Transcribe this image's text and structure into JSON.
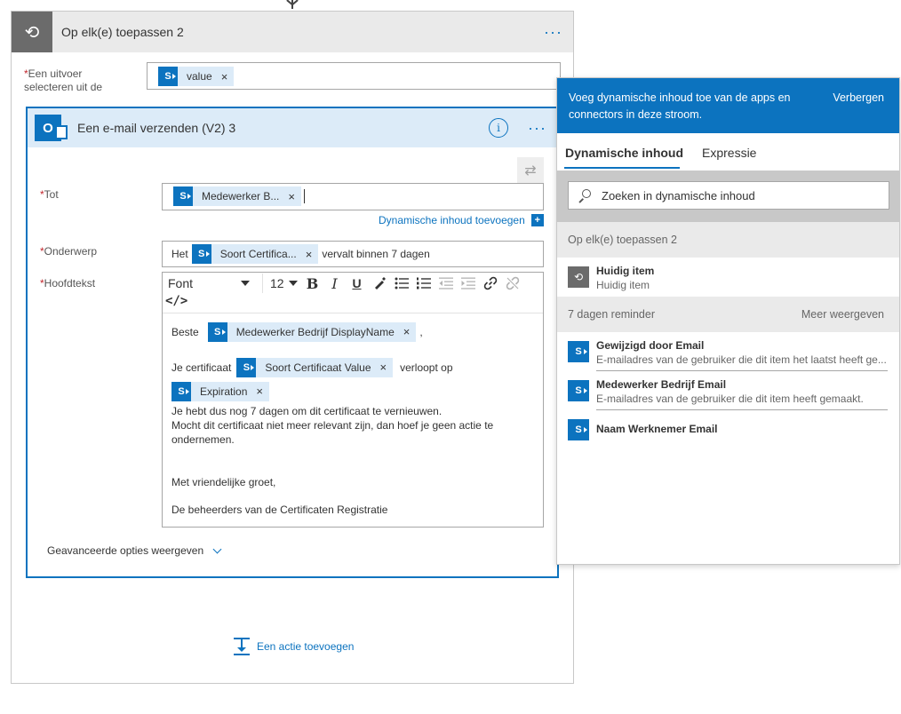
{
  "loop": {
    "title": "Op elk(e) toepassen 2",
    "more": "···",
    "select_label_req": "*",
    "select_label": "Een uitvoer selecteren uit de",
    "select_token": "value"
  },
  "email": {
    "title": "Een e-mail verzenden (V2) 3",
    "info": "i",
    "more": "···",
    "to_label": "Tot",
    "to_token": "Medewerker B...",
    "dynamic_link": "Dynamische inhoud toevoegen",
    "subject_label": "Onderwerp",
    "subject_prefix": "Het",
    "subject_token": "Soort Certifica...",
    "subject_suffix": "vervalt binnen 7 dagen",
    "body_label": "Hoofdtekst",
    "toolbar": {
      "font": "Font",
      "size": "12",
      "bold": "B",
      "italic": "I",
      "underline": "U",
      "code": "</>"
    },
    "body": {
      "greeting": "Beste",
      "greeting_token": "Medewerker Bedrijf DisplayName",
      "greeting_end": ",",
      "line2_prefix": "Je certificaat",
      "line2_token": "Soort Certificaat Value",
      "line2_suffix": "verloopt op",
      "line3_token": "Expiration",
      "line4": "Je hebt dus nog 7 dagen om dit certificaat te vernieuwen.",
      "line5": "Mocht dit certificaat niet meer relevant zijn, dan hoef je geen actie te",
      "line6": "ondernemen.",
      "closing": "Met vriendelijke groet,",
      "signature": "De beheerders van de Certificaten Registratie"
    },
    "advanced": "Geavanceerde opties weergeven"
  },
  "add_action": "Een actie toevoegen",
  "panel": {
    "header_text": "Voeg dynamische inhoud toe van de apps en connectors in deze stroom.",
    "hide": "Verbergen",
    "tab_dynamic": "Dynamische inhoud",
    "tab_expression": "Expressie",
    "search_placeholder": "Zoeken in dynamische inhoud",
    "section1": "Op elk(e) toepassen 2",
    "section1_items": [
      {
        "name": "Huidig item",
        "sub": "Huidig item"
      }
    ],
    "section2": "7 dagen reminder",
    "section2_more": "Meer weergeven",
    "section2_items": [
      {
        "name": "Gewijzigd door Email",
        "sub": "E-mailadres van de gebruiker die dit item het laatst heeft ge..."
      },
      {
        "name": "Medewerker Bedrijf Email",
        "sub": "E-mailadres van de gebruiker die dit item heeft gemaakt."
      },
      {
        "name": "Naam Werknemer Email",
        "sub": ""
      }
    ]
  },
  "colors": {
    "accent": "#0c73bf",
    "token_bg": "#dcebf8",
    "required": "#c2262c"
  }
}
